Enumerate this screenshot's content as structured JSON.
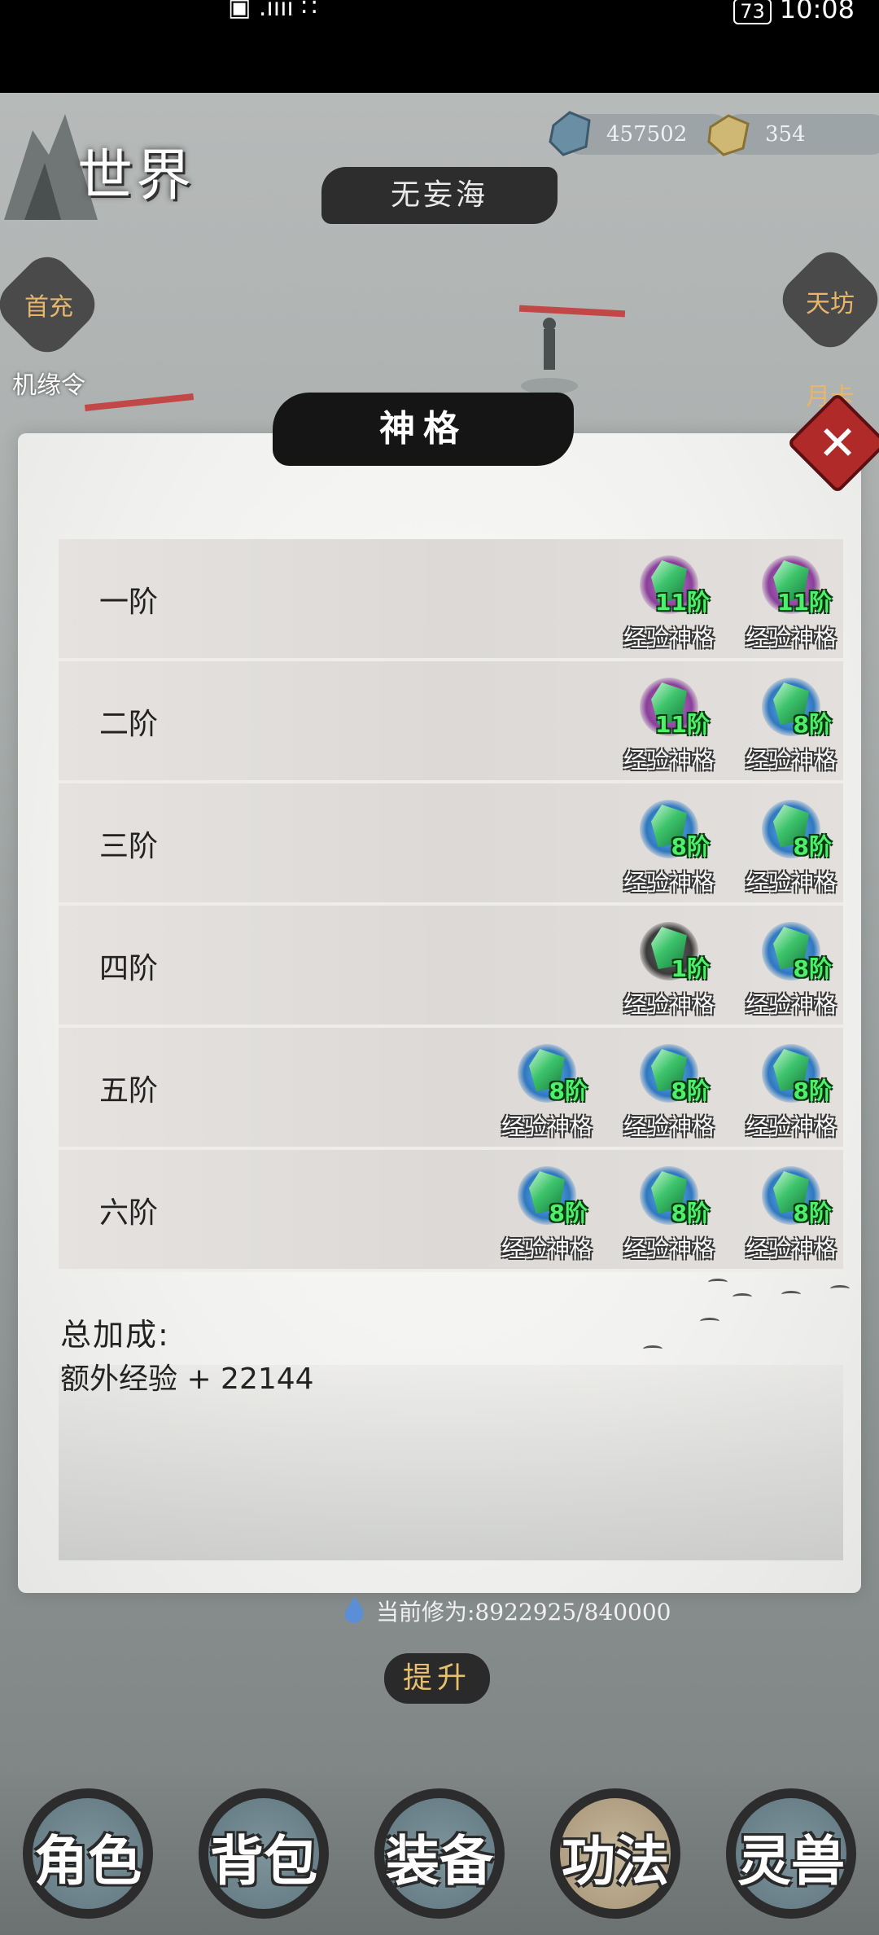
{
  "status_bar": {
    "left": "▣ .ıııı ∷",
    "battery": "73",
    "time": "10:08"
  },
  "hud": {
    "world_title": "世界",
    "resources": [
      {
        "icon": "blue-crystal-icon",
        "value": "457502"
      },
      {
        "icon": "gold-ingot-icon",
        "value": "354"
      }
    ],
    "location": "无妄海",
    "left_buttons": [
      "首充",
      "机缘令"
    ],
    "right_buttons": [
      "天坊",
      "月卡"
    ]
  },
  "dialog": {
    "title": "神格",
    "rows": [
      {
        "label": "一阶",
        "items": [
          {
            "name": "经验神格",
            "level": "11阶",
            "color": "purple"
          },
          {
            "name": "经验神格",
            "level": "11阶",
            "color": "purple"
          }
        ]
      },
      {
        "label": "二阶",
        "items": [
          {
            "name": "经验神格",
            "level": "11阶",
            "color": "purple"
          },
          {
            "name": "经验神格",
            "level": "8阶",
            "color": "blue"
          }
        ]
      },
      {
        "label": "三阶",
        "items": [
          {
            "name": "经验神格",
            "level": "8阶",
            "color": "blue"
          },
          {
            "name": "经验神格",
            "level": "8阶",
            "color": "blue"
          }
        ]
      },
      {
        "label": "四阶",
        "items": [
          {
            "name": "经验神格",
            "level": "1阶",
            "color": "dark"
          },
          {
            "name": "经验神格",
            "level": "8阶",
            "color": "blue"
          }
        ]
      },
      {
        "label": "五阶",
        "items": [
          {
            "name": "经验神格",
            "level": "8阶",
            "color": "blue"
          },
          {
            "name": "经验神格",
            "level": "8阶",
            "color": "blue"
          },
          {
            "name": "经验神格",
            "level": "8阶",
            "color": "blue"
          }
        ]
      },
      {
        "label": "六阶",
        "items": [
          {
            "name": "经验神格",
            "level": "8阶",
            "color": "blue"
          },
          {
            "name": "经验神格",
            "level": "8阶",
            "color": "blue"
          },
          {
            "name": "经验神格",
            "level": "8阶",
            "color": "blue"
          }
        ]
      }
    ],
    "total_label": "总加成:",
    "total_value": "额外经验 + 22144",
    "close_label": "✕"
  },
  "cultivation": {
    "text": "当前修为:8922925/840000"
  },
  "upgrade_button": "提升",
  "bottom_nav": [
    {
      "label": "角色",
      "active": false
    },
    {
      "label": "背包",
      "active": false
    },
    {
      "label": "装备",
      "active": false
    },
    {
      "label": "功法",
      "active": true
    },
    {
      "label": "灵兽",
      "active": false
    }
  ]
}
